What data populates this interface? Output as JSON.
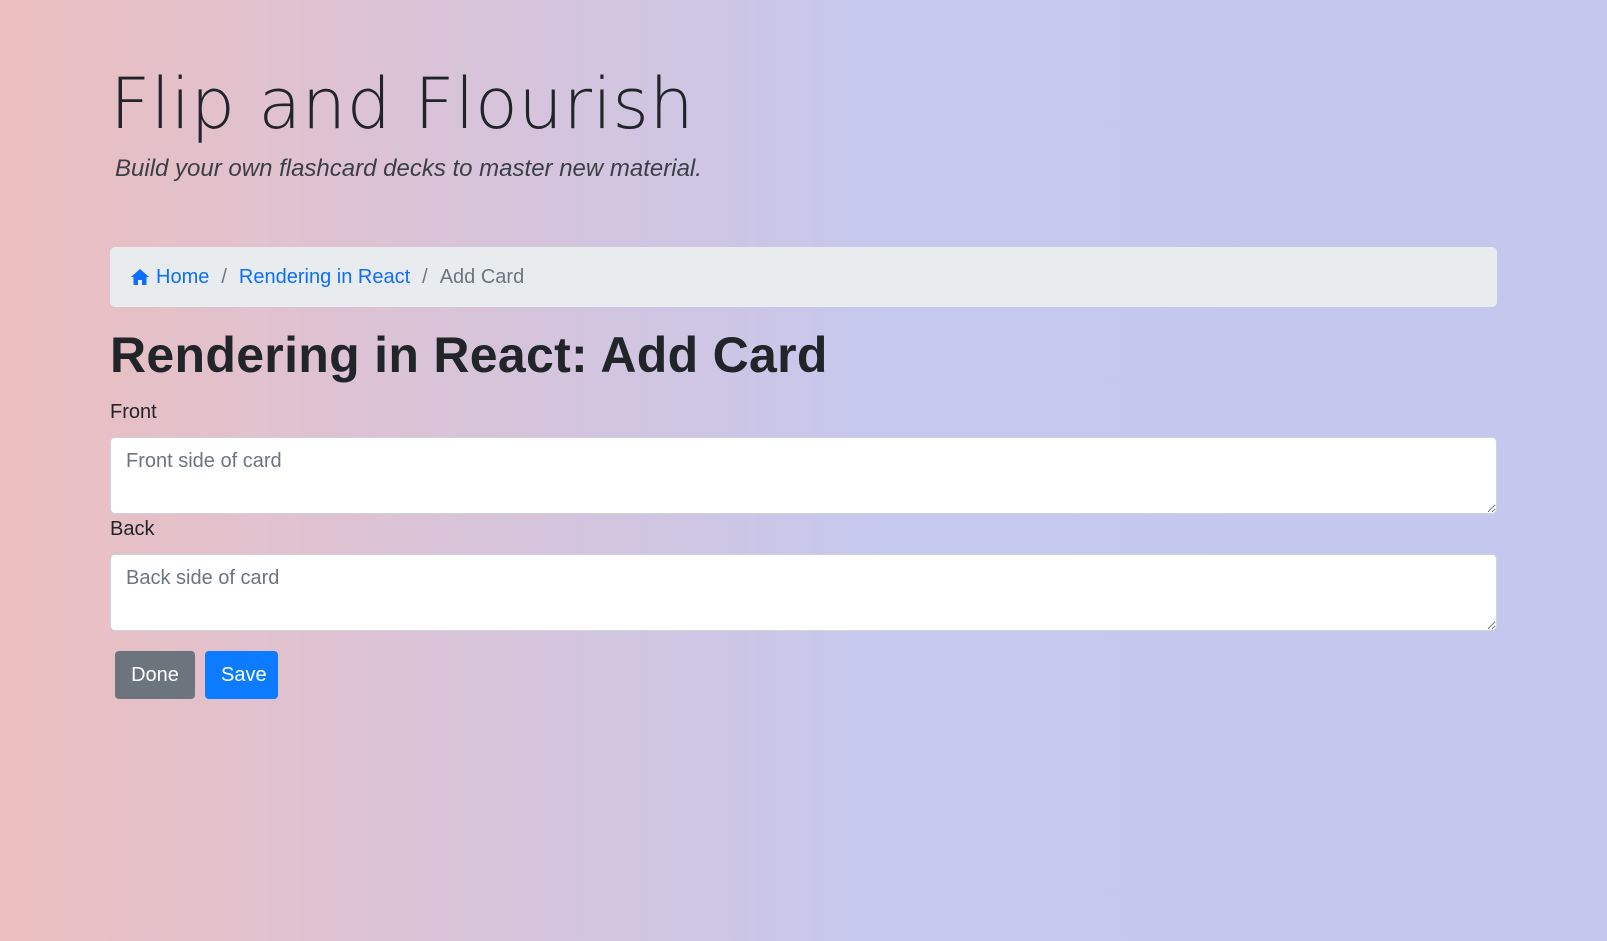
{
  "header": {
    "title": "Flip and Flourish",
    "subtitle": "Build your own flashcard decks to master new material."
  },
  "breadcrumb": {
    "home_icon": "home-icon",
    "home_label": "Home",
    "deck_label": "Rendering in React",
    "current_label": "Add Card",
    "separator": "/",
    "link_color": "#0d6efd"
  },
  "main": {
    "heading": "Rendering in React: Add Card",
    "front": {
      "label": "Front",
      "placeholder": "Front side of card",
      "value": ""
    },
    "back": {
      "label": "Back",
      "placeholder": "Back side of card",
      "value": ""
    },
    "buttons": {
      "done_label": "Done",
      "save_label": "Save",
      "done_color": "#6c757d",
      "save_color": "#0d7bff"
    }
  }
}
